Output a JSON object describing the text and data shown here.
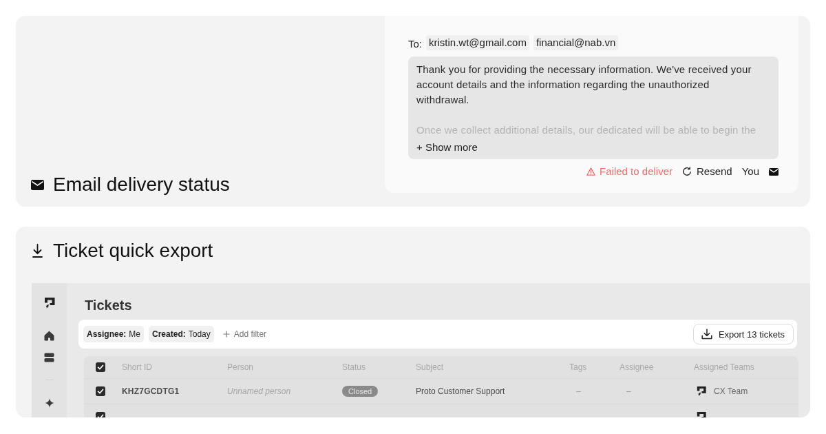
{
  "email_delivery": {
    "title": "Email delivery status",
    "message_card": {
      "to_label": "To:",
      "recipients": [
        "kristin.wt@gmail.com",
        "financial@nab.vn"
      ],
      "expanded": false,
      "body": [
        "Thank you for providing the necessary information. We've received your account details and the information regarding the unauthorized withdrawal.",
        "Once we collect additional details, our dedicated will be able to begin the"
      ],
      "show_more": "+ Show more",
      "delivery_status": {
        "kind": "failed",
        "label": "Failed to deliver"
      },
      "resend": "Resend",
      "sender": "You"
    }
  },
  "ticket_export": {
    "title": "Ticket quick export",
    "app": {
      "page_title": "Tickets",
      "filters": [
        {
          "label": "Assignee:",
          "value": "Me"
        },
        {
          "label": "Created:",
          "value": "Today"
        }
      ],
      "add_filter": "Add filter",
      "export_button": "Export 13 tickets",
      "table": {
        "header_checked": true,
        "columns": [
          "Short ID",
          "Person",
          "Status",
          "Subject",
          "Tags",
          "Assignee",
          "Assigned Teams"
        ],
        "rows": [
          {
            "checked": true,
            "short_id": "KHZ7GCDTG1",
            "person": "Unnamed person",
            "status": "Closed",
            "subject": "Proto Customer Support",
            "tags": "–",
            "assignee": "–",
            "team": "CX Team"
          },
          {
            "checked": true
          }
        ]
      }
    }
  }
}
